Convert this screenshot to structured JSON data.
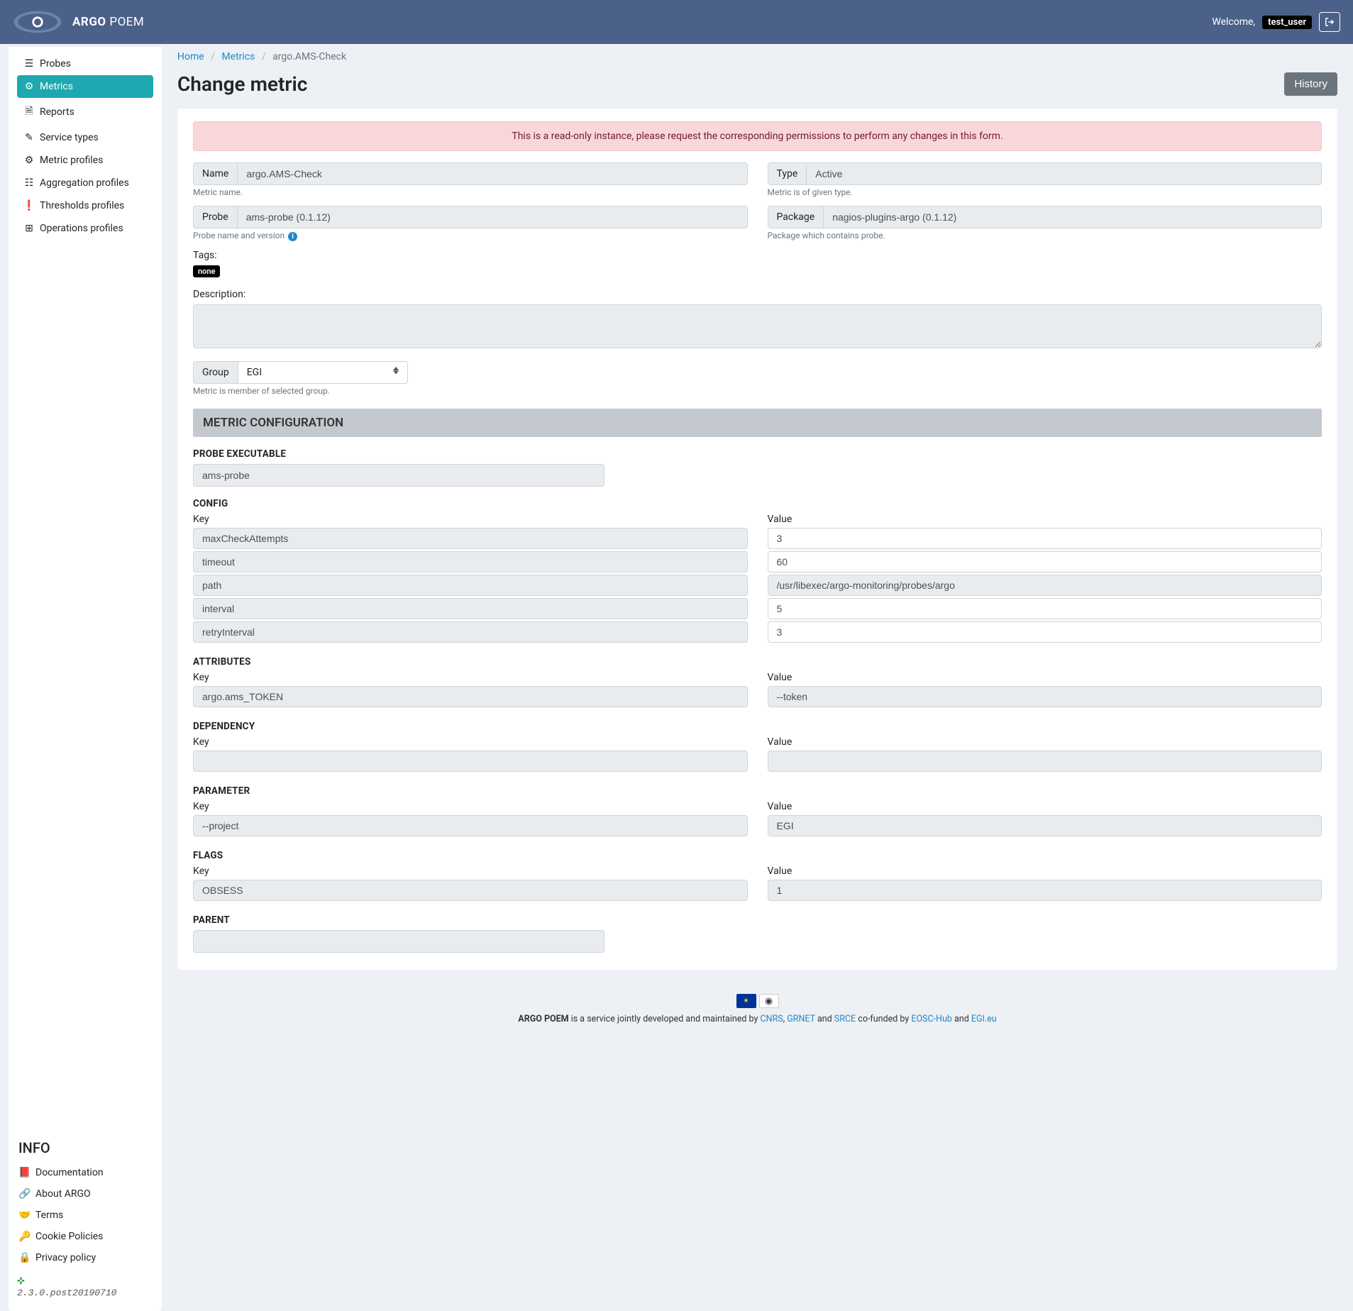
{
  "brand": {
    "bold": "ARGO",
    "light": "POEM"
  },
  "header": {
    "welcome": "Welcome,",
    "user": "test_user"
  },
  "sidebar": {
    "items": [
      {
        "label": "Probes"
      },
      {
        "label": "Metrics"
      },
      {
        "label": "Reports"
      },
      {
        "label": "Service types"
      },
      {
        "label": "Metric profiles"
      },
      {
        "label": "Aggregation profiles"
      },
      {
        "label": "Thresholds profiles"
      },
      {
        "label": "Operations profiles"
      }
    ],
    "info_title": "INFO",
    "info": [
      {
        "label": "Documentation"
      },
      {
        "label": "About ARGO"
      },
      {
        "label": "Terms"
      },
      {
        "label": "Cookie Policies"
      },
      {
        "label": "Privacy policy"
      }
    ],
    "version": "2.3.0.post20190710"
  },
  "breadcrumb": {
    "home": "Home",
    "metrics": "Metrics",
    "current": "argo.AMS-Check"
  },
  "page": {
    "title": "Change metric",
    "history_btn": "History"
  },
  "alert": "This is a read-only instance, please request the corresponding permissions to perform any changes in this form.",
  "form": {
    "name_label": "Name",
    "name_value": "argo.AMS-Check",
    "name_help": "Metric name.",
    "type_label": "Type",
    "type_value": "Active",
    "type_help": "Metric is of given type.",
    "probe_label": "Probe",
    "probe_value": "ams-probe (0.1.12)",
    "probe_help": "Probe name and version",
    "package_label": "Package",
    "package_value": "nagios-plugins-argo (0.1.12)",
    "package_help": "Package which contains probe.",
    "tags_label": "Tags:",
    "tags_value": "none",
    "desc_label": "Description:",
    "group_label": "Group",
    "group_value": "EGI",
    "group_help": "Metric is member of selected group."
  },
  "config": {
    "header": "METRIC CONFIGURATION",
    "probe_exec_title": "PROBE EXECUTABLE",
    "probe_exec_value": "ams-probe",
    "config_title": "CONFIG",
    "key_label": "Key",
    "value_label": "Value",
    "rows": [
      {
        "k": "maxCheckAttempts",
        "v": "3",
        "vwhite": true
      },
      {
        "k": "timeout",
        "v": "60",
        "vwhite": true
      },
      {
        "k": "path",
        "v": "/usr/libexec/argo-monitoring/probes/argo",
        "vwhite": false
      },
      {
        "k": "interval",
        "v": "5",
        "vwhite": true
      },
      {
        "k": "retryInterval",
        "v": "3",
        "vwhite": true
      }
    ],
    "attr_title": "ATTRIBUTES",
    "attr_rows": [
      {
        "k": "argo.ams_TOKEN",
        "v": "--token"
      }
    ],
    "dep_title": "DEPENDENCY",
    "dep_rows": [
      {
        "k": "",
        "v": ""
      }
    ],
    "param_title": "PARAMETER",
    "param_rows": [
      {
        "k": "--project",
        "v": "EGI"
      }
    ],
    "flags_title": "FLAGS",
    "flags_rows": [
      {
        "k": "OBSESS",
        "v": "1"
      }
    ],
    "parent_title": "PARENT"
  },
  "footer": {
    "text1": "ARGO POEM",
    "text2": " is a service jointly developed and maintained by ",
    "cnrs": "CNRS",
    "grnet": "GRNET",
    "srce": "SRCE",
    "and": " and ",
    "cofunded": " co-funded by ",
    "eosc": "EOSC-Hub",
    "egi": "EGI.eu",
    "comma": ", "
  }
}
